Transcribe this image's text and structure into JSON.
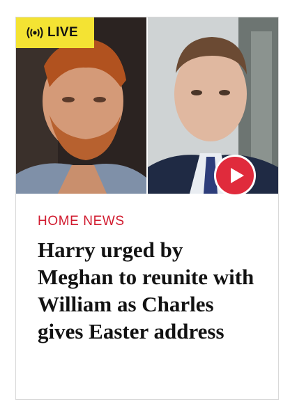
{
  "card": {
    "badge": {
      "label": "LIVE",
      "icon": "live-broadcast-icon",
      "color": "#f4e333"
    },
    "media": {
      "left_photo": "portrait-photo",
      "right_photo": "portrait-photo",
      "play_icon": "play-icon",
      "play_color": "#e02b3c"
    },
    "kicker": "HOME NEWS",
    "kicker_color": "#d11b2f",
    "headline": "Harry urged by Meghan to reunite with William as Charles gives Easter address"
  }
}
